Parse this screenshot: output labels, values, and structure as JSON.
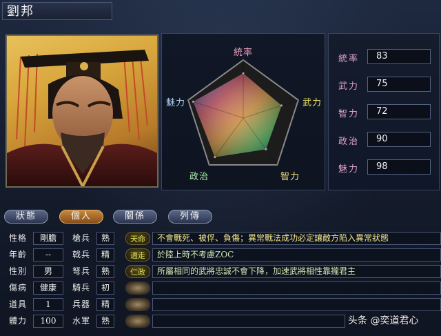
{
  "character": {
    "name": "劉邦"
  },
  "radar": {
    "labels": [
      "統率",
      "武力",
      "智力",
      "政治",
      "魅力"
    ],
    "values": [
      83,
      75,
      72,
      90,
      98
    ]
  },
  "stats": [
    {
      "label": "統率",
      "value": "83"
    },
    {
      "label": "武力",
      "value": "75"
    },
    {
      "label": "智力",
      "value": "72"
    },
    {
      "label": "政治",
      "value": "90"
    },
    {
      "label": "魅力",
      "value": "98"
    }
  ],
  "tabs": [
    "狀態",
    "個人",
    "關係",
    "列傳"
  ],
  "active_tab": "個人",
  "attributes": [
    {
      "label": "性格",
      "value": "剛膽"
    },
    {
      "label": "年齡",
      "value": "--"
    },
    {
      "label": "性別",
      "value": "男"
    },
    {
      "label": "傷病",
      "value": "健康"
    },
    {
      "label": "道具",
      "value": "1"
    },
    {
      "label": "體力",
      "value": "100"
    }
  ],
  "aptitudes": [
    {
      "label": "槍兵",
      "value": "熟"
    },
    {
      "label": "戟兵",
      "value": "精"
    },
    {
      "label": "弩兵",
      "value": "熟"
    },
    {
      "label": "騎兵",
      "value": "初"
    },
    {
      "label": "兵器",
      "value": "精"
    },
    {
      "label": "水軍",
      "value": "熟"
    }
  ],
  "skills": [
    {
      "name": "天命",
      "desc": "不會戰死、被俘、負傷；異常戰法成功必定讓敵方陷入異常狀態"
    },
    {
      "name": "適走",
      "desc": "於陸上時不考慮ZOC"
    },
    {
      "name": "仁政",
      "desc": "所屬相同的武將忠誠不會下降，加速武將相性靠攏君主"
    },
    {
      "name": "",
      "desc": ""
    },
    {
      "name": "",
      "desc": ""
    },
    {
      "name": "",
      "desc": ""
    }
  ],
  "watermark": "头条 @奕道君心",
  "colors": {
    "stat_label": "#e2a3c8",
    "active_tab": "#c68a3b"
  }
}
